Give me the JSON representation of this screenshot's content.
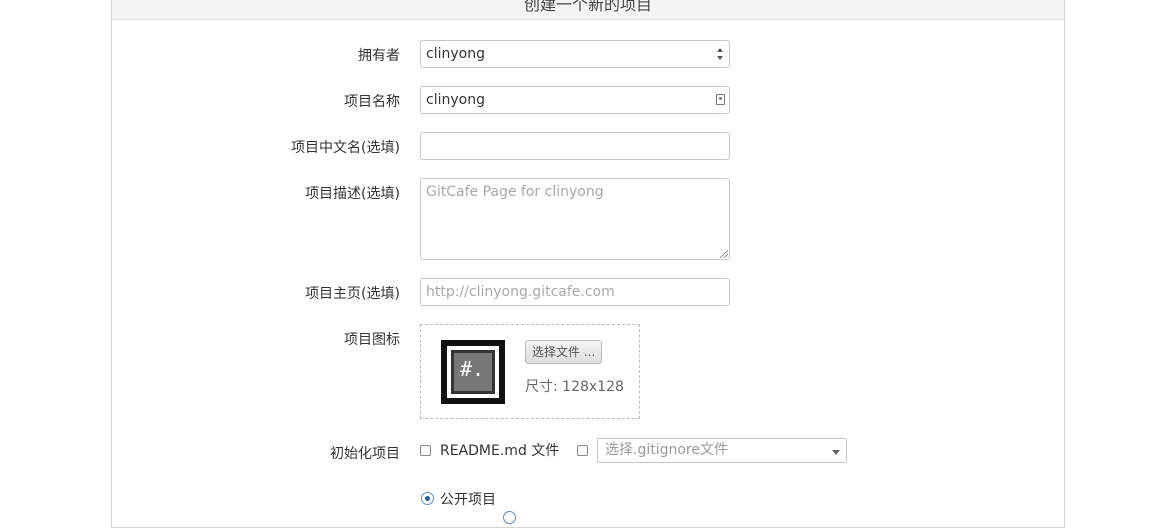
{
  "form": {
    "title": "创建一个新的项目",
    "owner": {
      "label": "拥有者",
      "value": "clinyong"
    },
    "name": {
      "label": "项目名称",
      "value": "clinyong"
    },
    "cn_name": {
      "label": "项目中文名(选填)",
      "value": ""
    },
    "description": {
      "label": "项目描述(选填)",
      "placeholder": "GitCafe Page for clinyong"
    },
    "homepage": {
      "label": "项目主页(选填)",
      "placeholder": "http://clinyong.gitcafe.com"
    },
    "icon": {
      "label": "项目图标",
      "choose_button": "选择文件 ...",
      "size_text": "尺寸: 128x128",
      "glyph": "#."
    },
    "init": {
      "label": "初始化项目",
      "readme_label": "README.md 文件",
      "readme_checked": false,
      "gitignore_checked": false,
      "gitignore_placeholder": "选择.gitignore文件"
    },
    "visibility": {
      "public_label": "公开项目",
      "public_selected": true
    }
  },
  "icons": [
    "updown-arrows-icon",
    "contact-card-icon",
    "chevron-down-icon",
    "project-icon"
  ]
}
